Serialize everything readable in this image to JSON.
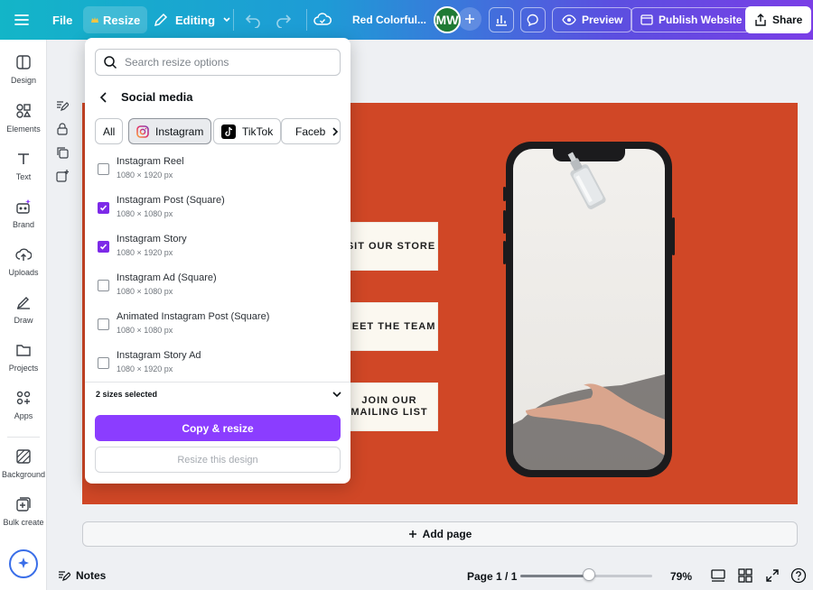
{
  "topbar": {
    "file_label": "File",
    "resize_label": "Resize",
    "editing_label": "Editing",
    "doc_title": "Red Colorful...",
    "avatar_initials": "MW",
    "preview_label": "Preview",
    "publish_label": "Publish Website",
    "share_label": "Share",
    "gradient_start": "#13b5c8",
    "gradient_end": "#7a3ee6"
  },
  "sidebar": {
    "items": [
      {
        "label": "Design",
        "icon": "design-icon"
      },
      {
        "label": "Elements",
        "icon": "elements-icon"
      },
      {
        "label": "Text",
        "icon": "text-icon"
      },
      {
        "label": "Brand",
        "icon": "brand-icon"
      },
      {
        "label": "Uploads",
        "icon": "uploads-icon"
      },
      {
        "label": "Draw",
        "icon": "draw-icon"
      },
      {
        "label": "Projects",
        "icon": "projects-icon"
      },
      {
        "label": "Apps",
        "icon": "apps-icon"
      },
      {
        "label": "Background",
        "icon": "background-icon"
      },
      {
        "label": "Bulk create",
        "icon": "bulk-create-icon"
      }
    ]
  },
  "resize_popup": {
    "search_placeholder": "Search resize options",
    "section_title": "Social media",
    "chips": [
      {
        "label": "All"
      },
      {
        "label": "Instagram"
      },
      {
        "label": "TikTok"
      },
      {
        "label": "Faceb"
      }
    ],
    "options": [
      {
        "name": "Instagram Reel",
        "dims": "1080 × 1920 px",
        "checked": false
      },
      {
        "name": "Instagram Post (Square)",
        "dims": "1080 × 1080 px",
        "checked": true
      },
      {
        "name": "Instagram Story",
        "dims": "1080 × 1920 px",
        "checked": true
      },
      {
        "name": "Instagram Ad (Square)",
        "dims": "1080 × 1080 px",
        "checked": false
      },
      {
        "name": "Animated Instagram Post (Square)",
        "dims": "1080 × 1080 px",
        "checked": false
      },
      {
        "name": "Instagram Story Ad",
        "dims": "1080 × 1920 px",
        "checked": false
      }
    ],
    "sizes_selected": "2 sizes selected",
    "copy_resize_label": "Copy & resize",
    "resize_design_label": "Resize this design",
    "accent": "#8b3dff"
  },
  "canvas": {
    "background": "#d04726",
    "links": [
      {
        "text": "ISIT OUR STORE"
      },
      {
        "text": "MEET THE TEAM"
      },
      {
        "text": "JOIN OUR MAILING LIST"
      }
    ],
    "add_page_label": "Add page"
  },
  "bottombar": {
    "notes_label": "Notes",
    "page_indicator": "Page 1 / 1",
    "zoom_label": "79%",
    "zoom_fraction": 0.52
  }
}
